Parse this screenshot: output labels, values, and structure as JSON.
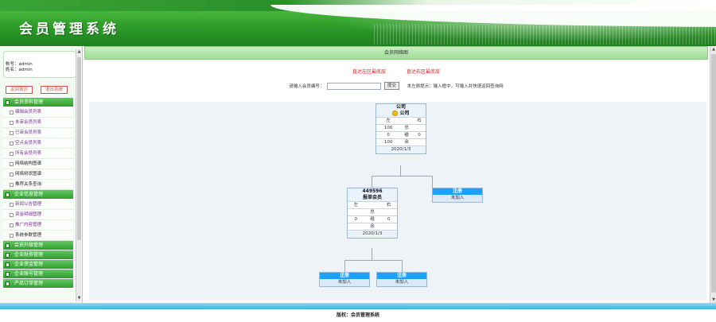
{
  "header": {
    "title": "会员管理系统"
  },
  "sidebar": {
    "user": {
      "account_label": "帐号：",
      "account": "admin",
      "name_label": "姓名：",
      "name": "admin"
    },
    "home_button": "返回首页",
    "logout_button": "退出系统",
    "groups": [
      {
        "label": "会员资料管理",
        "items": [
          "编辑会员列表",
          "未审会员列表",
          "已审会员列表",
          "空点会员列表",
          "所有会员列表",
          "网络结构图谱",
          "网络树状图谱",
          "推荐关系查询"
        ]
      },
      {
        "label": "企业信息管理",
        "items": [
          "新闻公告管理",
          "资金明细管理",
          "推广内容管理",
          "系统参数管理"
        ]
      },
      {
        "label": "会员升级管理",
        "items": []
      },
      {
        "label": "企业财务管理",
        "items": []
      },
      {
        "label": "企业资金管理",
        "items": []
      },
      {
        "label": "企业账号管理",
        "items": []
      },
      {
        "label": "产品订单管理",
        "items": []
      }
    ]
  },
  "main": {
    "panel_title": "会员网络图",
    "link_left": "直达左区最底层",
    "link_right": "直达右区最底层",
    "search_label": "请输入会员编号：",
    "search_value": "",
    "search_button": "提交",
    "hint": "本左侧提示：输入框中，可输入并快速返回查询网",
    "tree": {
      "root": {
        "id": "公司",
        "name": "公司",
        "left_label": "左",
        "right_label": "右",
        "row1": [
          "100",
          "总",
          ""
        ],
        "row2": [
          "0",
          "碰",
          "0"
        ],
        "row3": [
          "100",
          "余",
          ""
        ],
        "date": "2020/1/3"
      },
      "child": {
        "id": "449596",
        "name": "报单会员",
        "left_label": "左",
        "right_label": "右",
        "row1": [
          "",
          "总",
          ""
        ],
        "row2": [
          "0",
          "碰",
          "0"
        ],
        "row3": [
          "",
          "余",
          ""
        ],
        "date": "2020/1/3"
      },
      "empty_title": "注册",
      "empty_sub": "未加入"
    }
  },
  "footer": {
    "text": "版权：会员管理系统"
  }
}
